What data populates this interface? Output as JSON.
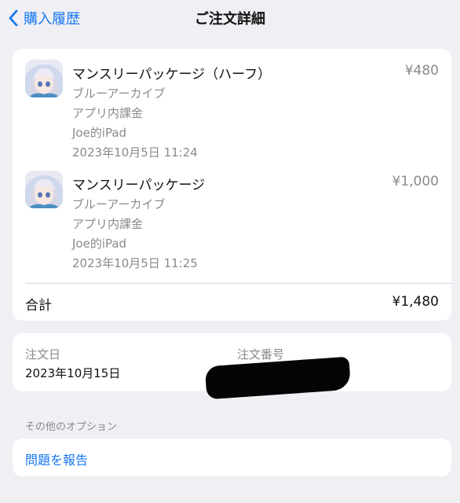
{
  "nav": {
    "back_label": "購入履歴",
    "title": "ご注文詳細"
  },
  "items": [
    {
      "name": "マンスリーパッケージ（ハーフ）",
      "price": "¥480",
      "developer": "ブルーアーカイブ",
      "type": "アプリ内課金",
      "device": "Joe的iPad",
      "date": "2023年10月5日 11:24",
      "icon": "app-icon"
    },
    {
      "name": "マンスリーパッケージ",
      "price": "¥1,000",
      "developer": "ブルーアーカイブ",
      "type": "アプリ内課金",
      "device": "Joe的iPad",
      "date": "2023年10月5日 11:25",
      "icon": "app-icon"
    }
  ],
  "total": {
    "label": "合計",
    "value": "¥1,480"
  },
  "order": {
    "date_label": "注文日",
    "date_value": "2023年10月15日",
    "number_label": "注文番号"
  },
  "options": {
    "header": "その他のオプション",
    "report_label": "問題を報告"
  },
  "colors": {
    "accent": "#1677f2",
    "secondary_text": "#8a8a8e",
    "background": "#efeff4"
  }
}
